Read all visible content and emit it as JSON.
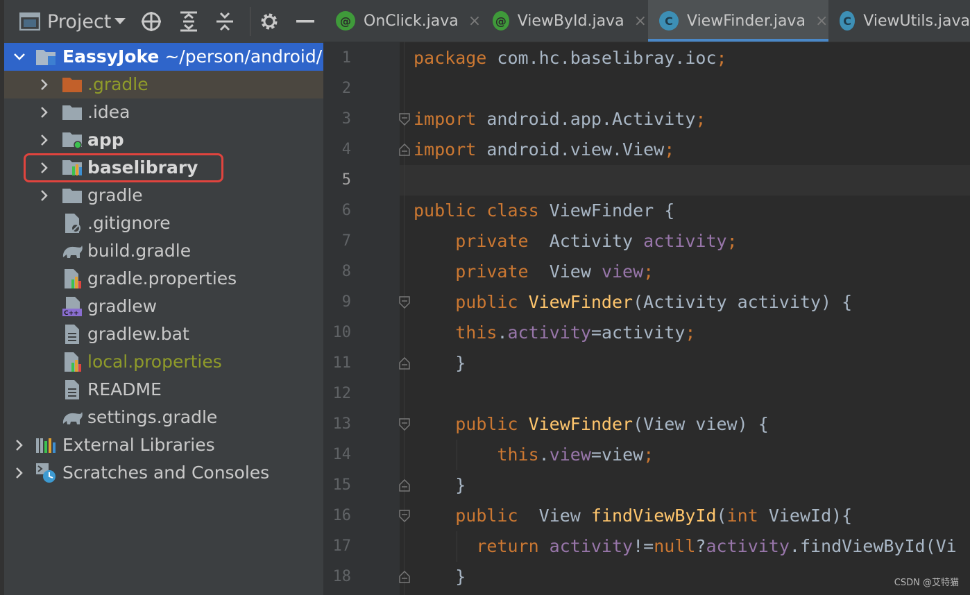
{
  "project_panel": {
    "view_label": "Project",
    "tree": [
      {
        "key": "root",
        "label": "EassyJoke",
        "path": " ~/person/android/l",
        "icon": "module-folder-icon",
        "expanded": true
      },
      {
        "key": "gradle-hidden",
        "label": ".gradle",
        "icon": "orange-folder-icon"
      },
      {
        "key": "idea",
        "label": ".idea",
        "icon": "folder-icon"
      },
      {
        "key": "app",
        "label": "app",
        "icon": "app-module-folder-icon"
      },
      {
        "key": "baselibrary",
        "label": "baselibrary",
        "icon": "library-module-folder-icon"
      },
      {
        "key": "gradle",
        "label": "gradle",
        "icon": "folder-icon"
      },
      {
        "key": "gitignore",
        "label": ".gitignore",
        "icon": "ignore-file-icon"
      },
      {
        "key": "build-gradle",
        "label": "build.gradle",
        "icon": "gradle-elephant-icon"
      },
      {
        "key": "gradle-properties",
        "label": "gradle.properties",
        "icon": "properties-file-icon"
      },
      {
        "key": "gradlew",
        "label": "gradlew",
        "icon": "cpp-file-icon"
      },
      {
        "key": "gradlew-bat",
        "label": "gradlew.bat",
        "icon": "text-file-icon"
      },
      {
        "key": "local-properties",
        "label": "local.properties",
        "icon": "properties-file-icon"
      },
      {
        "key": "readme",
        "label": "README",
        "icon": "text-file-icon"
      },
      {
        "key": "settings-gradle",
        "label": "settings.gradle",
        "icon": "gradle-elephant-icon"
      },
      {
        "key": "external-libraries",
        "label": "External Libraries",
        "icon": "libraries-icon"
      },
      {
        "key": "scratches",
        "label": "Scratches and Consoles",
        "icon": "scratches-icon"
      }
    ]
  },
  "tabs": [
    {
      "label": "OnClick.java",
      "icon": "annotation-icon",
      "glyph": "@",
      "active": false
    },
    {
      "label": "ViewById.java",
      "icon": "annotation-icon",
      "glyph": "@",
      "active": false
    },
    {
      "label": "ViewFinder.java",
      "icon": "class-icon",
      "glyph": "C",
      "active": true
    },
    {
      "label": "ViewUtils.java",
      "icon": "class-icon",
      "glyph": "C",
      "active": false
    }
  ],
  "tab_close_glyph": "×",
  "editor": {
    "current_line": 5,
    "lines": [
      {
        "n": "1",
        "tokens": [
          [
            "kw",
            "package "
          ],
          [
            "txt",
            "com.hc.baselibray.ioc"
          ],
          [
            "kw",
            ";"
          ]
        ]
      },
      {
        "n": "2",
        "tokens": []
      },
      {
        "n": "3",
        "tokens": [
          [
            "kw",
            "import "
          ],
          [
            "txt",
            "android.app.Activity"
          ],
          [
            "kw",
            ";"
          ]
        ]
      },
      {
        "n": "4",
        "tokens": [
          [
            "kw",
            "import "
          ],
          [
            "txt",
            "android.view.View"
          ],
          [
            "kw",
            ";"
          ]
        ]
      },
      {
        "n": "5",
        "tokens": []
      },
      {
        "n": "6",
        "tokens": [
          [
            "kw",
            "public class "
          ],
          [
            "txt",
            "ViewFinder {"
          ]
        ]
      },
      {
        "n": "7",
        "tokens": [
          [
            "txt",
            "    "
          ],
          [
            "kw",
            "private  "
          ],
          [
            "txt",
            "Activity "
          ],
          [
            "fld",
            "activity"
          ],
          [
            "kw",
            ";"
          ]
        ]
      },
      {
        "n": "8",
        "tokens": [
          [
            "txt",
            "    "
          ],
          [
            "kw",
            "private  "
          ],
          [
            "txt",
            "View "
          ],
          [
            "fld",
            "view"
          ],
          [
            "kw",
            ";"
          ]
        ]
      },
      {
        "n": "9",
        "tokens": [
          [
            "txt",
            "    "
          ],
          [
            "kw",
            "public "
          ],
          [
            "fn",
            "ViewFinder"
          ],
          [
            "txt",
            "(Activity activity) {"
          ]
        ]
      },
      {
        "n": "10",
        "tokens": [
          [
            "txt",
            "    "
          ],
          [
            "kw",
            "this"
          ],
          [
            "txt",
            "."
          ],
          [
            "fld",
            "activity"
          ],
          [
            "txt",
            "=activity"
          ],
          [
            "kw",
            ";"
          ]
        ]
      },
      {
        "n": "11",
        "tokens": [
          [
            "txt",
            "    }"
          ]
        ]
      },
      {
        "n": "12",
        "tokens": []
      },
      {
        "n": "13",
        "tokens": [
          [
            "txt",
            "    "
          ],
          [
            "kw",
            "public "
          ],
          [
            "fn",
            "ViewFinder"
          ],
          [
            "txt",
            "(View view) {"
          ]
        ]
      },
      {
        "n": "14",
        "tokens": [
          [
            "txt",
            "        "
          ],
          [
            "kw",
            "this"
          ],
          [
            "txt",
            "."
          ],
          [
            "fld",
            "view"
          ],
          [
            "txt",
            "=view"
          ],
          [
            "kw",
            ";"
          ]
        ]
      },
      {
        "n": "15",
        "tokens": [
          [
            "txt",
            "    }"
          ]
        ]
      },
      {
        "n": "16",
        "tokens": [
          [
            "txt",
            "    "
          ],
          [
            "kw",
            "public  "
          ],
          [
            "txt",
            "View "
          ],
          [
            "fn",
            "findViewById"
          ],
          [
            "txt",
            "("
          ],
          [
            "kw",
            "int "
          ],
          [
            "txt",
            "ViewId){"
          ]
        ]
      },
      {
        "n": "17",
        "tokens": [
          [
            "txt",
            "      "
          ],
          [
            "kw",
            "return "
          ],
          [
            "fld",
            "activity"
          ],
          [
            "txt",
            "!="
          ],
          [
            "kw",
            "null"
          ],
          [
            "txt",
            "?"
          ],
          [
            "fld",
            "activity"
          ],
          [
            "txt",
            ".findViewById(Vi"
          ]
        ]
      },
      {
        "n": "18",
        "tokens": [
          [
            "txt",
            "    }"
          ]
        ]
      }
    ]
  },
  "watermark": "CSDN @艾特猫",
  "colors": {
    "selection": "#2f65ca",
    "highlight_box": "#e0443e",
    "keyword": "#cc7832",
    "field": "#9876aa",
    "method": "#ffc66d"
  }
}
